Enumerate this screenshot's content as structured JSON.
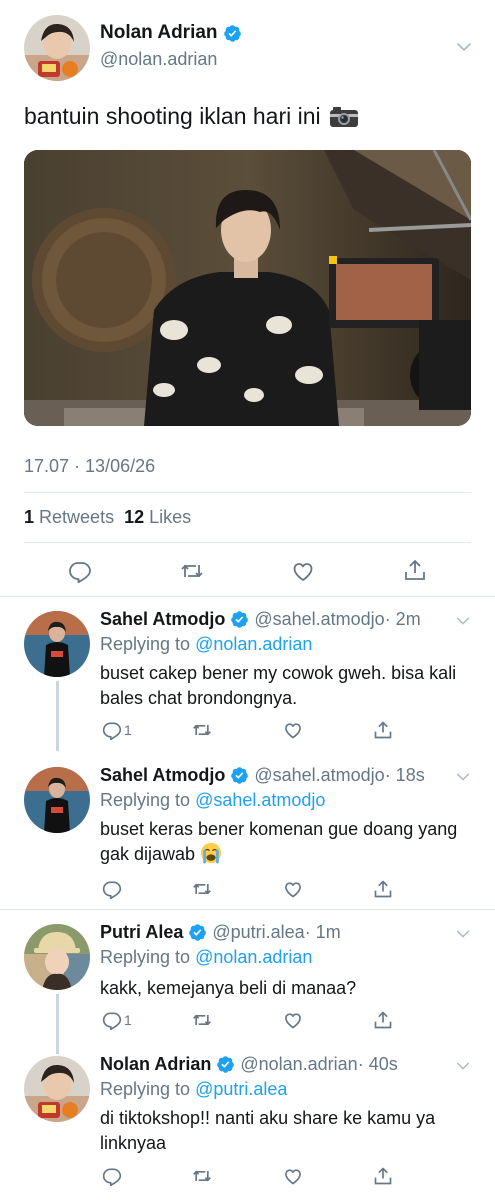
{
  "main": {
    "name": "Nolan Adrian",
    "handle": "@nolan.adrian",
    "text": "bantuin shooting iklan hari ini",
    "timestamp": "17.07 · 13/06/26",
    "retweets_count": "1",
    "retweets_label": "Retweets",
    "likes_count": "12",
    "likes_label": "Likes"
  },
  "replies": [
    {
      "name": "Sahel Atmodjo",
      "handle": "@sahel.atmodjo",
      "time": "· 2m",
      "replying_prefix": "Replying to",
      "replying_to": "@nolan.adrian",
      "text": "buset cakep bener my cowok gweh. bisa kali bales chat brondongnya.",
      "reply_count": "1"
    },
    {
      "name": "Sahel Atmodjo",
      "handle": "@sahel.atmodjo",
      "time": "· 18s",
      "replying_prefix": "Replying to",
      "replying_to": "@sahel.atmodjo",
      "text": "buset keras bener komenan gue doang yang gak dijawab",
      "reply_count": ""
    },
    {
      "name": "Putri Alea",
      "handle": "@putri.alea",
      "time": "· 1m",
      "replying_prefix": "Replying to",
      "replying_to": "@nolan.adrian",
      "text": "kakk, kemejanya beli di manaa?",
      "reply_count": "1"
    },
    {
      "name": "Nolan Adrian",
      "handle": "@nolan.adrian",
      "time": "· 40s",
      "replying_prefix": "Replying to",
      "replying_to": "@putri.alea",
      "text": "di tiktokshop!! nanti aku share ke kamu ya linknyaa",
      "reply_count": ""
    }
  ],
  "colors": {
    "accent": "#1da1f2",
    "secondary_text": "#657786",
    "divider": "#e1e8ed",
    "thread_line": "#ccd6dd"
  },
  "icons": [
    "verified-badge-icon",
    "chevron-down-icon",
    "camera-emoji-icon",
    "reply-icon",
    "retweet-icon",
    "like-icon",
    "share-icon",
    "crying-emoji-icon"
  ]
}
